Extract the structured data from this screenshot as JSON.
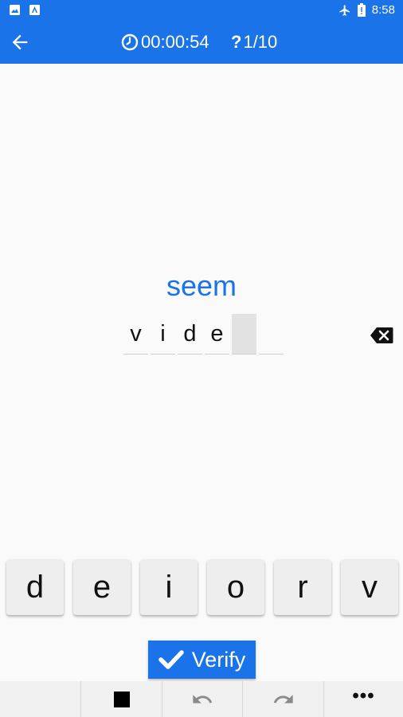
{
  "status_bar": {
    "time": "8:58",
    "icons": [
      "image-icon",
      "app-notification-icon",
      "airplane-mode-icon",
      "battery-icon"
    ]
  },
  "app_bar": {
    "timer": "00:00:54",
    "progress": "1/10",
    "icons": [
      "back-arrow-icon",
      "clock-icon",
      "question-icon"
    ]
  },
  "quiz": {
    "prompt": "seem",
    "letters": [
      "v",
      "i",
      "d",
      "e",
      "",
      ""
    ]
  },
  "keyboard": {
    "keys": [
      "d",
      "e",
      "i",
      "o",
      "r",
      "v"
    ]
  },
  "verify_button": {
    "label": "Verify"
  },
  "toolbar": {
    "icons": [
      "stop-icon",
      "undo-icon",
      "redo-icon",
      "more-icon"
    ],
    "more_label": "•••"
  },
  "colors": {
    "accent": "#1a73e8",
    "background": "#fafafa",
    "key_bg": "#eeeeee"
  }
}
